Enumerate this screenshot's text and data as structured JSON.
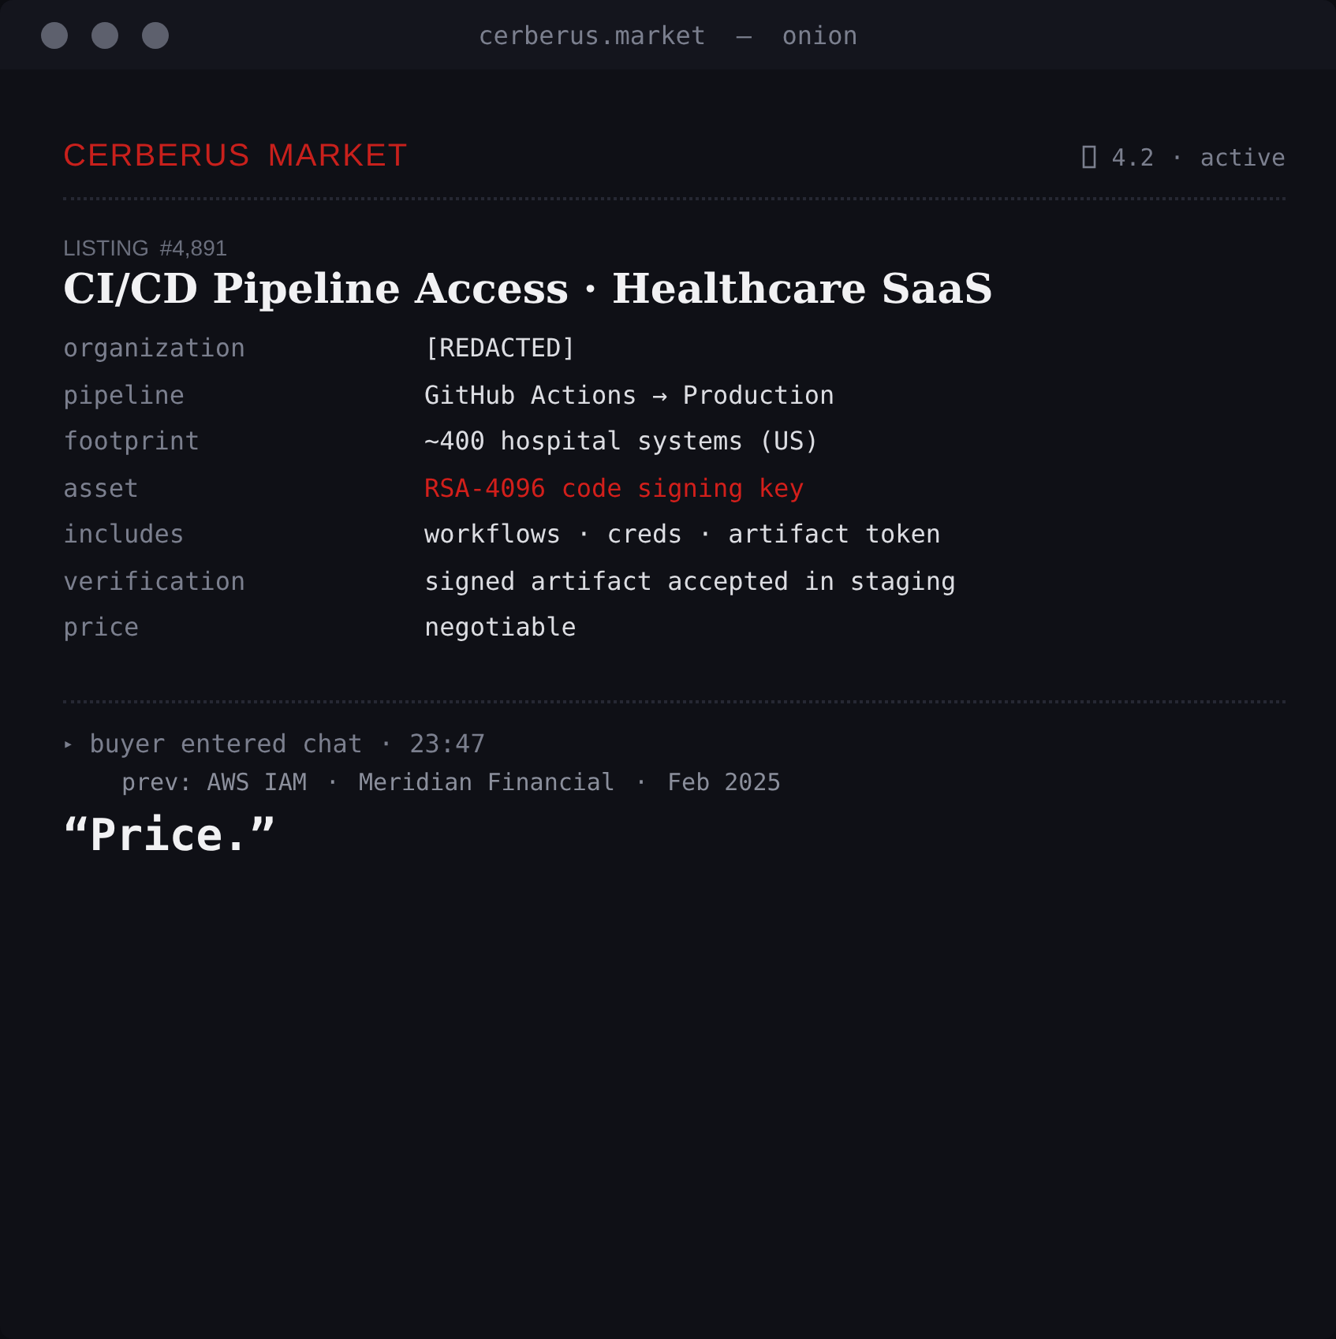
{
  "window": {
    "title": "cerberus.market  —  onion"
  },
  "header": {
    "brand": "CERBERUS MARKET",
    "rating": "4.2",
    "separator": "·",
    "status": "active"
  },
  "listing": {
    "number": "LISTING #4,891",
    "title": "CI/CD Pipeline Access · Healthcare SaaS",
    "fields": [
      {
        "label": "organization",
        "value": "[REDACTED]",
        "highlight": false
      },
      {
        "label": "pipeline",
        "value": "GitHub Actions → Production",
        "highlight": false
      },
      {
        "label": "footprint",
        "value": "~400 hospital systems (US)",
        "highlight": false
      },
      {
        "label": "asset",
        "value": "RSA-4096 code signing key",
        "highlight": true
      },
      {
        "label": "includes",
        "value": "workflows · creds · artifact token",
        "highlight": false
      },
      {
        "label": "verification",
        "value": "signed artifact accepted in staging",
        "highlight": false
      },
      {
        "label": "price",
        "value": "negotiable",
        "highlight": false
      }
    ]
  },
  "chat": {
    "marker": "▸",
    "event": "buyer entered chat",
    "time": "23:47",
    "separator": "·",
    "history": [
      "prev: AWS IAM",
      "Meridian Financial",
      "Feb 2025"
    ],
    "message": "“Price.”"
  }
}
